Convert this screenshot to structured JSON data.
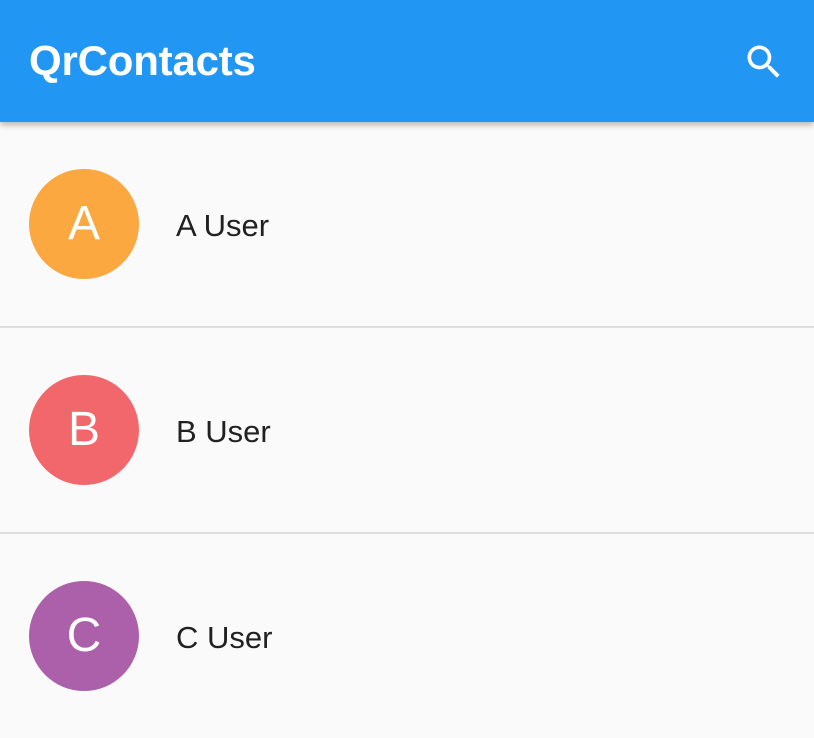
{
  "app_bar": {
    "title": "QrContacts",
    "background_color": "#2196f3",
    "search_icon": "search-icon"
  },
  "contacts": [
    {
      "initial": "A",
      "name": "A User",
      "avatar_color": "#fba840"
    },
    {
      "initial": "B",
      "name": "B User",
      "avatar_color": "#f2676b"
    },
    {
      "initial": "C",
      "name": "C User",
      "avatar_color": "#ac60a9"
    }
  ]
}
